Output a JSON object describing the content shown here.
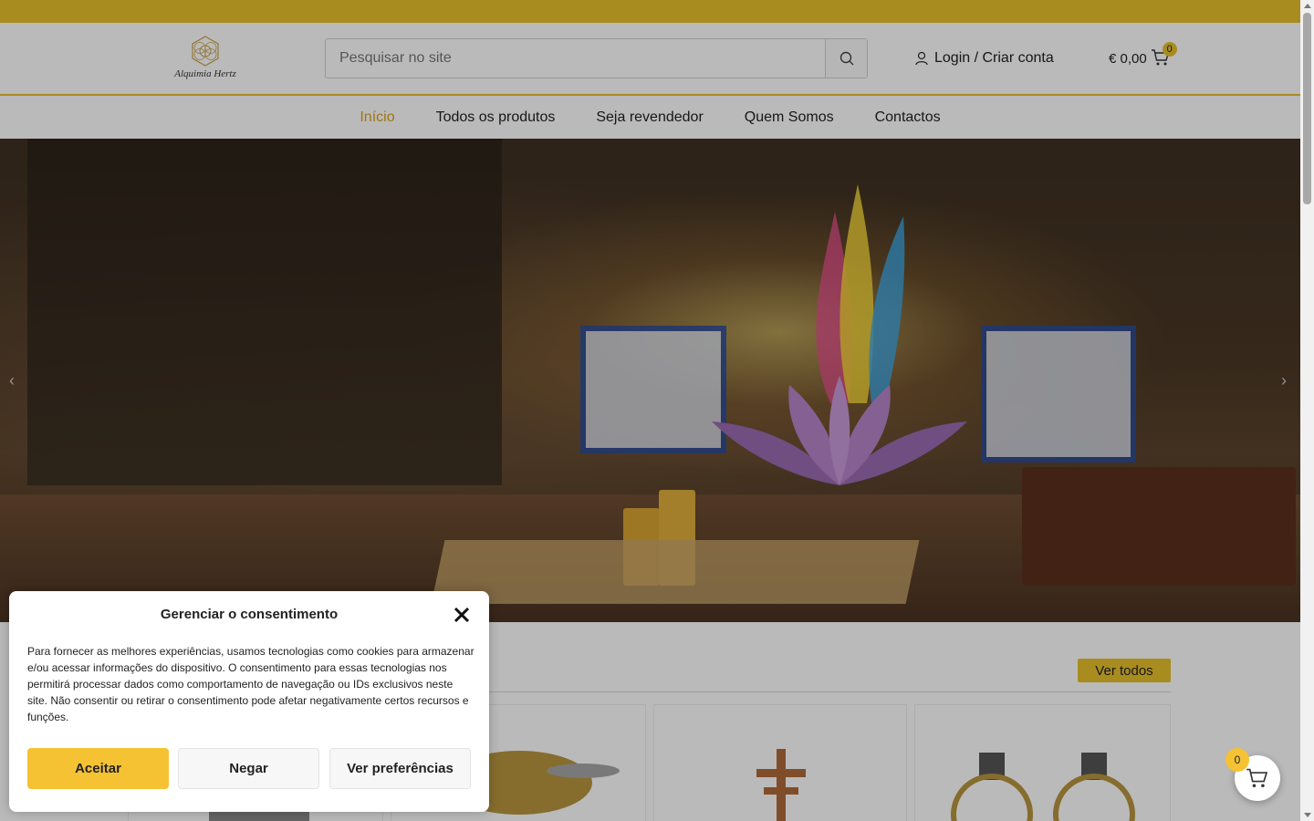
{
  "brand": {
    "logo_text": "Alquimia Hertz"
  },
  "search": {
    "placeholder": "Pesquisar no site"
  },
  "account": {
    "login_label": "Login / Criar conta"
  },
  "cart": {
    "total": "€ 0,00",
    "count": "0"
  },
  "nav": {
    "items": [
      {
        "label": "Início",
        "active": true
      },
      {
        "label": "Todos os produtos",
        "active": false
      },
      {
        "label": "Seja revendedor",
        "active": false
      },
      {
        "label": "Quem Somos",
        "active": false
      },
      {
        "label": "Contactos",
        "active": false
      }
    ]
  },
  "hero": {
    "prev_arrow": "‹",
    "next_arrow": "›"
  },
  "products_section": {
    "see_all_label": "Ver todos"
  },
  "consent": {
    "title": "Gerenciar o consentimento",
    "body": "Para fornecer as melhores experiências, usamos tecnologias como cookies para armazenar e/ou acessar informações do dispositivo. O consentimento para essas tecnologias nos permitirá processar dados como comportamento de navegação ou IDs exclusivos neste site. Não consentir ou retirar o consentimento pode afetar negativamente certos recursos e funções.",
    "accept_label": "Aceitar",
    "deny_label": "Negar",
    "prefs_label": "Ver preferências"
  },
  "floating_cart": {
    "count": "0"
  },
  "colors": {
    "accent": "#e6c12b",
    "accept_button": "#f5c233",
    "nav_active": "#d9a21a"
  },
  "icons": [
    "logo-hexagon-icon",
    "search-icon",
    "user-icon",
    "cart-icon",
    "close-icon",
    "chevron-left-icon",
    "chevron-right-icon"
  ]
}
